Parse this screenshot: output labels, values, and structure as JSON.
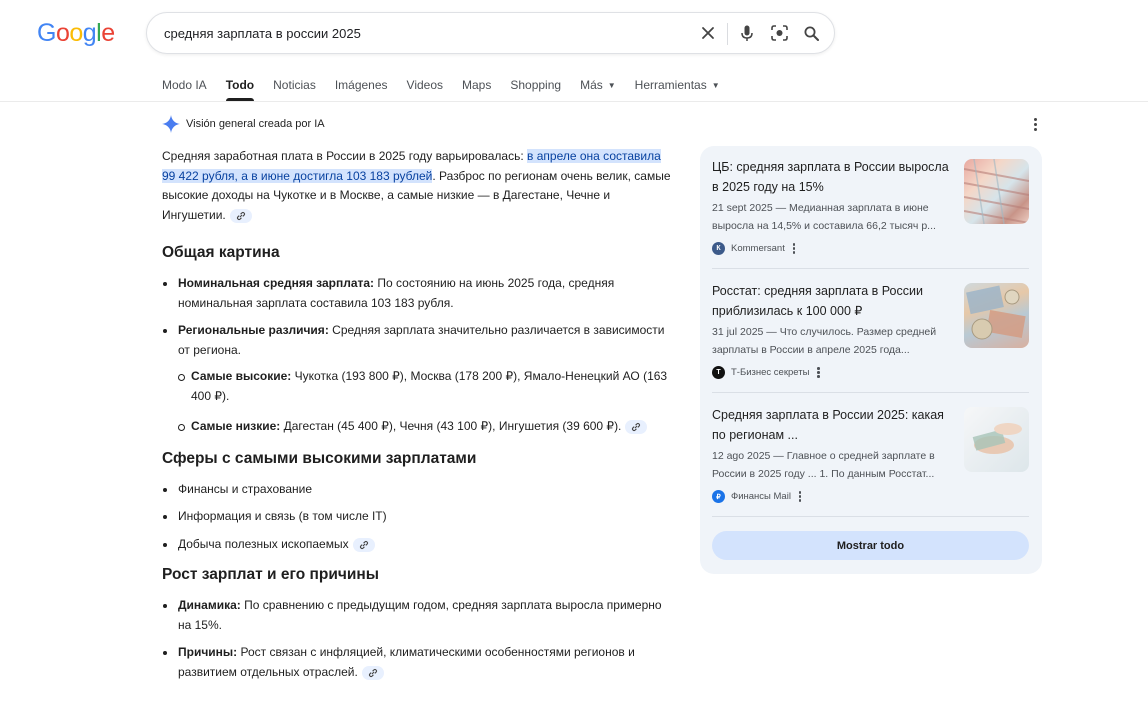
{
  "logo": {
    "text": "Google"
  },
  "search": {
    "query": "средняя зарплата в россии 2025"
  },
  "tabs": [
    "Modo IA",
    "Todo",
    "Noticias",
    "Imágenes",
    "Videos",
    "Maps",
    "Shopping",
    "Más",
    "Herramientas"
  ],
  "ai_overview": {
    "header": "Visión general creada por IA",
    "intro": {
      "before": "Средняя заработная плата в России в 2025 году варьировалась: ",
      "highlight": "в апреле она составила 99 422 рубля, а в июне достигла 103 183 рублей",
      "after": ". Разброс по регионам очень велик, самые высокие доходы на Чукотке и в Москве, а самые низкие — в Дагестане, Чечне и Ингушетии."
    },
    "sections": [
      {
        "heading": "Общая картина",
        "items": [
          {
            "bold": "Номинальная средняя зарплата:",
            "text": " По состоянию на июнь 2025 года, средняя номинальная зарплата составила 103 183 рубля."
          },
          {
            "bold": "Региональные различия:",
            "text": " Средняя зарплата значительно различается в зависимости от региона.",
            "subitems": [
              {
                "bold": "Самые высокие:",
                "text": " Чукотка (193 800 ₽), Москва (178 200 ₽), Ямало-Ненецкий АО (163 400 ₽)."
              },
              {
                "bold": "Самые низкие:",
                "text": " Дагестан (45 400 ₽), Чечня (43 100 ₽), Ингушетия (39 600 ₽)."
              }
            ]
          }
        ]
      },
      {
        "heading": "Сферы с самыми высокими зарплатами",
        "items": [
          "Финансы и страхование",
          "Информация и связь (в том числе IT)",
          "Добыча полезных ископаемых"
        ]
      },
      {
        "heading": "Рост зарплат и его причины",
        "items": [
          {
            "bold": "Динамика:",
            "text": " По сравнению с предыдущим годом, средняя зарплата выросла примерно на 15%."
          },
          {
            "bold": "Причины:",
            "text": " Рост связан с инфляцией, климатическими особенностями регионов и развитием отдельных отраслей."
          }
        ]
      }
    ]
  },
  "sources": [
    {
      "title": "ЦБ: средняя зарплата в России выросла в 2025 году на 15%",
      "snippet": "21 sept 2025 — Медианная зарплата в июне выросла на 14,5% и составила 66,2 тысяч р...",
      "site": "Kommersant",
      "icon_color": "#3c5a8a"
    },
    {
      "title": "Росстат: средняя зарплата в России приблизилась к 100 000 ₽",
      "snippet": "31 jul 2025 — Что случилось. Размер средней зарплаты в России в апреле 2025 года...",
      "site": "Т-Бизнес секреты",
      "icon_color": "#111111"
    },
    {
      "title": "Средняя зарплата в России 2025: какая по регионам ...",
      "snippet": "12 ago 2025 — Главное о средней зарплате в России в 2025 году ... 1. По данным Росстат...",
      "site": "Финансы Mail",
      "icon_color": "#1a73e8"
    }
  ],
  "show_all_label": "Mostrar todo",
  "colors": {
    "accent": "#1a73e8",
    "highlight_bg": "#d3e3fd",
    "panel_bg": "#f0f4f9"
  }
}
